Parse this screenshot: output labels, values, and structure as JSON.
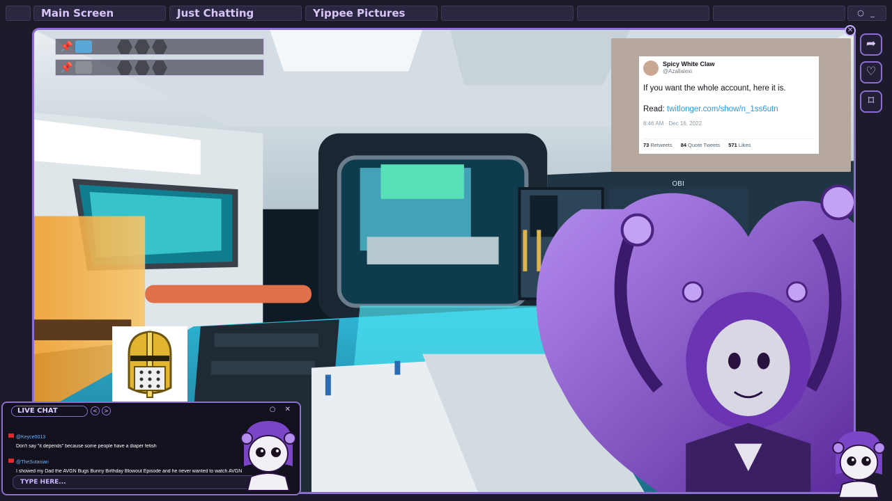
{
  "tabs": [
    {
      "label": "Main Screen"
    },
    {
      "label": "Just Chatting"
    },
    {
      "label": "Yippee Pictures"
    },
    {
      "label": ""
    },
    {
      "label": ""
    },
    {
      "label": ""
    }
  ],
  "window_controls": "○ _",
  "tweet": {
    "name": "Spicy White Claw",
    "handle": "@Azallalexi",
    "body": "If you want the whole account, here it is.",
    "read_label": "Read: ",
    "link": "twitlonger.com/show/n_1ss6utn",
    "time": "8:46 AM · Dec 16, 2022",
    "retweets": "73",
    "retweets_label": "Retweets",
    "quotes": "84",
    "quotes_label": "Quote Tweets",
    "likes": "571",
    "likes_label": "Likes"
  },
  "game_sign": "OBI",
  "chat": {
    "title": "LIVE CHAT",
    "controls": "○ ✕",
    "messages": [
      {
        "user": "@Keyce0013",
        "text": "Don't say \"it depends\" because some people have a diaper fetish"
      },
      {
        "user": "@TheSutanian",
        "text": "I showed my Dad the AVGN Bugs Bunny Birthday Blowout Episode and he never wanted to watch AVGN"
      }
    ],
    "input_placeholder": "TYPE HERE..."
  },
  "colors": {
    "accent": "#8a6fd1",
    "tab_text": "#d9c4f7",
    "background": "#1d1a2b"
  },
  "icons": [
    "pin-icon",
    "share-icon",
    "heart-icon",
    "bookmark-icon",
    "close-icon",
    "knight-helmet-icon"
  ]
}
